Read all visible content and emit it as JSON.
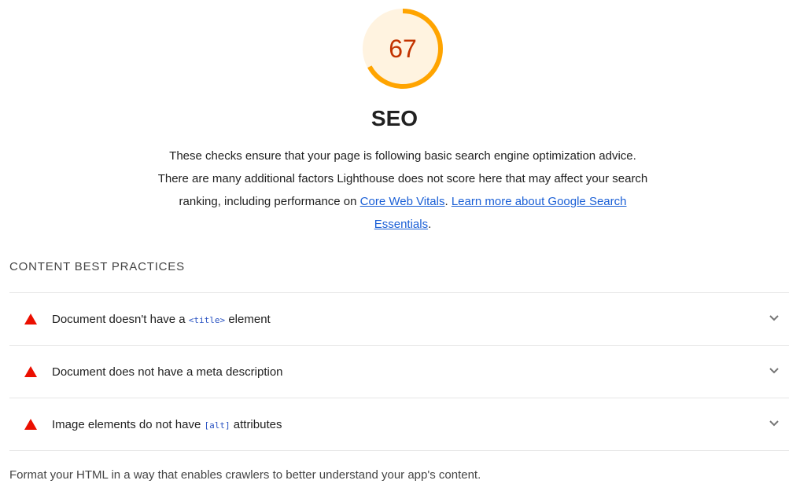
{
  "score": {
    "value": "67",
    "fraction": 0.67,
    "color": "#ffa400",
    "text_color": "#c33300",
    "background": "#fff3e0"
  },
  "category": {
    "title": "SEO",
    "description": "These checks ensure that your page is following basic search engine optimization advice. There are many additional factors Lighthouse does not score here that may affect your search ranking, including performance on",
    "link_core_web_vitals": "Core Web Vitals",
    "separator": ".",
    "link_learn_more": "Learn more about Google Search Essentials",
    "end": "."
  },
  "group": {
    "title": "CONTENT BEST PRACTICES",
    "description": "Format your HTML in a way that enables crawlers to better understand your app's content."
  },
  "audits": [
    {
      "pre": "Document doesn't have a ",
      "code": "<title>",
      "post": " element",
      "status_icon": "fail-triangle-icon"
    },
    {
      "pre": "Document does not have a meta description",
      "code": "",
      "post": "",
      "status_icon": "fail-triangle-icon"
    },
    {
      "pre": "Image elements do not have ",
      "code": "[alt]",
      "post": " attributes",
      "status_icon": "fail-triangle-icon"
    }
  ],
  "colors": {
    "fail": "#eb0f00",
    "link": "#1a5fd6"
  }
}
